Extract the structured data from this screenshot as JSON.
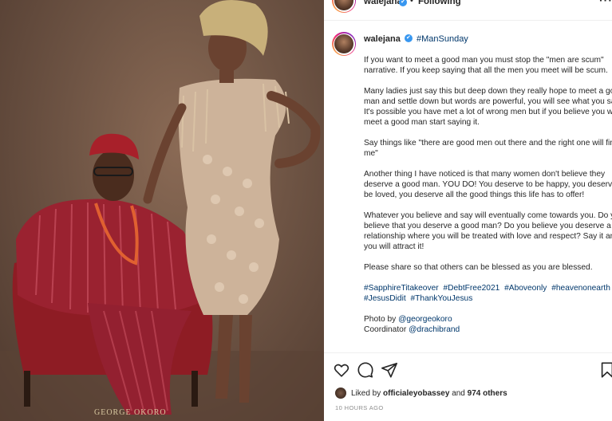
{
  "post": {
    "username": "walejana",
    "verified_icon": "verified-badge-icon",
    "follow_status": "Following",
    "header_dot": "•",
    "more_icon": "ellipsis-icon",
    "photo_credit": "GEORGE OKORO"
  },
  "caption": {
    "username": "walejana",
    "hashtag": "#ManSunday",
    "paragraphs": [
      "If you want to meet a good man you must stop the \"men are scum\" narrative. If you keep saying that all the men you meet will be scum.",
      "Many ladies just say this but deep down they really hope to meet a good man and settle down but words are powerful, you will see what you say. It's possible you have met a lot of wrong men but if you believe you will meet a good man start saying it.",
      "Say things like \"there are good men out there and the right one will find me\"",
      "Another thing I have noticed is that many women don't believe they deserve a good man. YOU DO! You deserve to be happy, you deserve to be loved, you deserve all the good things this life has to offer!",
      "Whatever you believe and say will eventually come towards you. Do you believe that you deserve a good man? Do you believe you deserve a relationship where you will be treated with love and respect? Say it and you will attract it!",
      "Please share so that others can be blessed as you are blessed."
    ],
    "hashtags": [
      "#SapphireTitakeover",
      "#DebtFree2021",
      "#Aboveonly",
      "#heavenonearth",
      "#JesusDidit",
      "#ThankYouJesus"
    ],
    "photo_by_label": "Photo by",
    "photo_by_handle": "@georgeokoro",
    "coordinator_label": "Coordinator",
    "coordinator_handle": "@drachibrand"
  },
  "actions": {
    "like_icon": "heart-icon",
    "comment_icon": "comment-icon",
    "share_icon": "share-icon",
    "save_icon": "bookmark-icon",
    "liked_prefix": "Liked by",
    "liked_user": "officialeyobassey",
    "liked_and": "and",
    "liked_others": "974 others",
    "timestamp": "10 hours ago"
  }
}
